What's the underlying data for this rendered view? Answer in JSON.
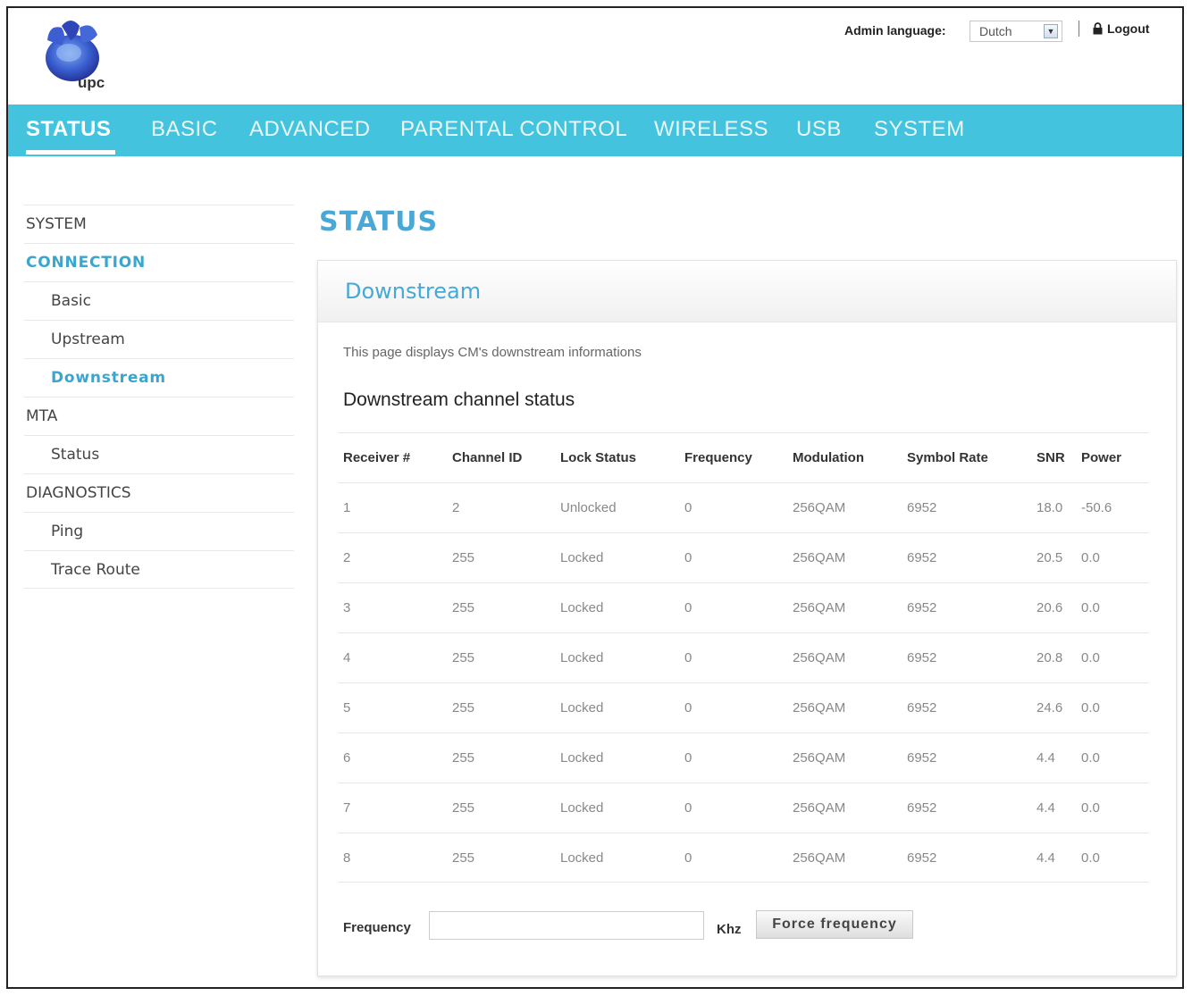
{
  "header": {
    "logo_text": "upc",
    "admin_language_label": "Admin language:",
    "language_value": "Dutch",
    "logout_label": "Logout"
  },
  "nav": {
    "tabs": [
      {
        "label": "STATUS",
        "active": true
      },
      {
        "label": "BASIC"
      },
      {
        "label": "ADVANCED"
      },
      {
        "label": "PARENTAL CONTROL"
      },
      {
        "label": "WIRELESS"
      },
      {
        "label": "USB"
      },
      {
        "label": "SYSTEM"
      }
    ]
  },
  "sidebar": {
    "items": [
      {
        "label": "SYSTEM"
      },
      {
        "label": "CONNECTION"
      },
      {
        "label": "Basic"
      },
      {
        "label": "Upstream"
      },
      {
        "label": "Downstream"
      },
      {
        "label": "MTA"
      },
      {
        "label": "Status"
      },
      {
        "label": "DIAGNOSTICS"
      },
      {
        "label": "Ping"
      },
      {
        "label": "Trace Route"
      }
    ]
  },
  "main": {
    "page_title": "STATUS",
    "panel_title": "Downstream",
    "description": "This page displays CM's downstream informations",
    "subheading": "Downstream channel status",
    "table": {
      "headers": [
        "Receiver #",
        "Channel ID",
        "Lock Status",
        "Frequency",
        "Modulation",
        "Symbol Rate",
        "SNR",
        "Power"
      ],
      "rows": [
        [
          "1",
          "2",
          "Unlocked",
          "0",
          "256QAM",
          "6952",
          "18.0",
          "-50.6"
        ],
        [
          "2",
          "255",
          "Locked",
          "0",
          "256QAM",
          "6952",
          "20.5",
          "0.0"
        ],
        [
          "3",
          "255",
          "Locked",
          "0",
          "256QAM",
          "6952",
          "20.6",
          "0.0"
        ],
        [
          "4",
          "255",
          "Locked",
          "0",
          "256QAM",
          "6952",
          "20.8",
          "0.0"
        ],
        [
          "5",
          "255",
          "Locked",
          "0",
          "256QAM",
          "6952",
          "24.6",
          "0.0"
        ],
        [
          "6",
          "255",
          "Locked",
          "0",
          "256QAM",
          "6952",
          "4.4",
          "0.0"
        ],
        [
          "7",
          "255",
          "Locked",
          "0",
          "256QAM",
          "6952",
          "4.4",
          "0.0"
        ],
        [
          "8",
          "255",
          "Locked",
          "0",
          "256QAM",
          "6952",
          "4.4",
          "0.0"
        ]
      ]
    },
    "frequency_label": "Frequency",
    "frequency_value": "",
    "unit_label": "Khz",
    "force_button_label": "Force frequency"
  },
  "colors": {
    "nav_bar": "#44c3de",
    "accent_blue": "#4aa8d6",
    "sidebar_highlight": "#3aa6cf"
  }
}
